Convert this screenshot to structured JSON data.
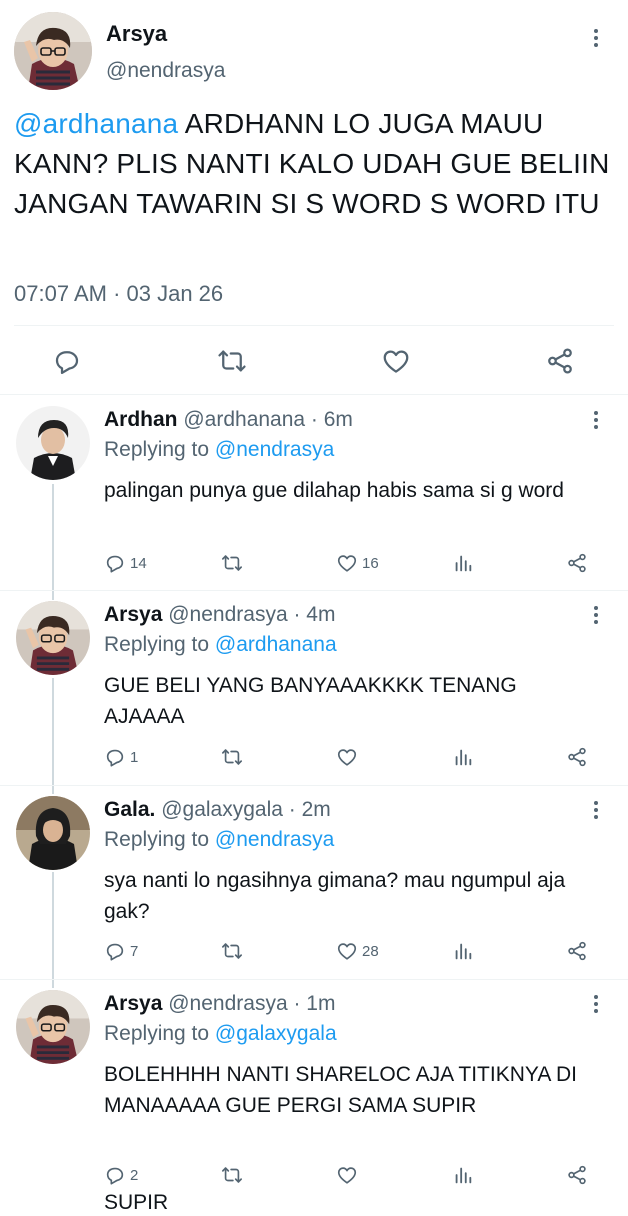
{
  "main_tweet": {
    "name": "Arsya",
    "handle": "@nendrasya",
    "mention": "@ardhanana",
    "text": " ARDHANN LO JUGA MAUU KANN? PLIS NANTI KALO UDAH GUE BELIIN JANGAN TAWARIN SI S WORD S WORD ITU",
    "timestamp": "07:07 AM · 03 Jan 26",
    "actions": [
      "reply-icon",
      "retweet-icon",
      "like-icon",
      "share-icon"
    ]
  },
  "replies": [
    {
      "name": "Ardhan",
      "meta": "@ardhanana · 6m",
      "replying_label": "Replying to",
      "replying_to": "@nendrasya",
      "text": "palingan punya gue dilahap habis sama si g word",
      "reply_count": "14",
      "retweet_count": "",
      "like_count": "16"
    },
    {
      "name": "Arsya",
      "meta": "@nendrasya · 4m",
      "replying_label": "Replying to",
      "replying_to": "@ardhanana",
      "text": "GUE BELI YANG BANYAAAKKKK TENANG AJAAAA",
      "reply_count": "1",
      "retweet_count": "",
      "like_count": ""
    },
    {
      "name": "Gala.",
      "meta": "@galaxygala · 2m",
      "replying_label": "Replying to",
      "replying_to": "@nendrasya",
      "text": "sya nanti lo ngasihnya gimana? mau ngumpul aja gak?",
      "reply_count": "7",
      "retweet_count": "",
      "like_count": "28"
    },
    {
      "name": "Arsya",
      "meta": "@nendrasya · 1m",
      "replying_label": "Replying to",
      "replying_to": "@galaxygala",
      "text": "BOLEHHHH NANTI SHARELOC AJA TITIKNYA DI MANAAAAA GUE PERGI SAMA SUPIR",
      "reply_count": "2",
      "retweet_count": "",
      "like_count": ""
    }
  ],
  "cutoff_text": "SUPIR",
  "colors": {
    "link": "#1d9bf0",
    "secondary": "#536471",
    "divider": "#eff3f4",
    "thread_line": "#cfd9de"
  }
}
